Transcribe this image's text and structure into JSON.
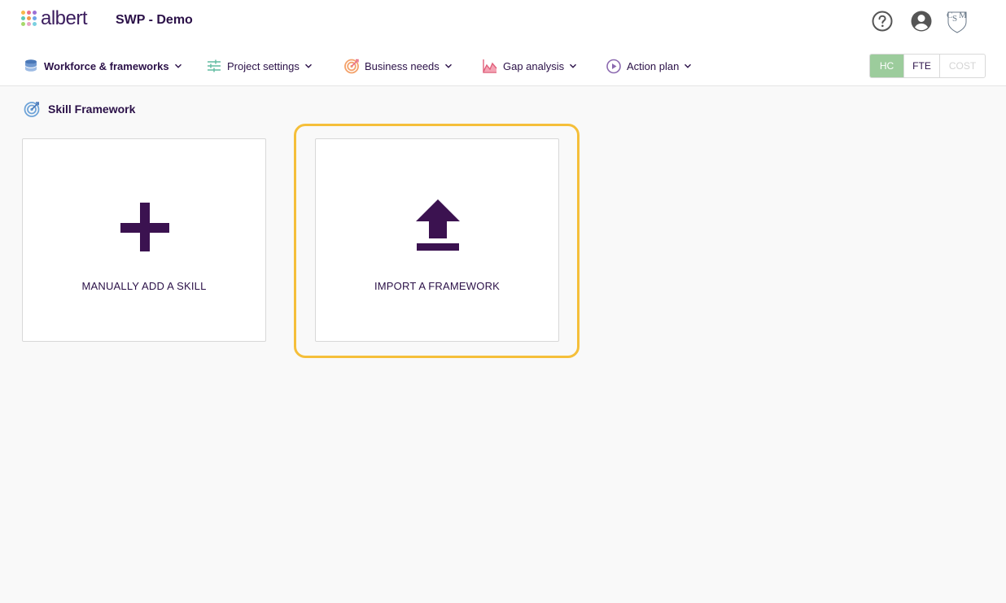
{
  "app": {
    "logo_text": "albert",
    "title": "SWP - Demo"
  },
  "nav": {
    "items": [
      {
        "label": "Workforce & frameworks",
        "icon": "database-icon"
      },
      {
        "label": "Project settings",
        "icon": "sliders-icon"
      },
      {
        "label": "Business needs",
        "icon": "target-icon"
      },
      {
        "label": "Gap analysis",
        "icon": "area-chart-icon"
      },
      {
        "label": "Action plan",
        "icon": "play-circle-icon"
      }
    ]
  },
  "view_toggle": {
    "options": [
      "HC",
      "FTE",
      "COST"
    ],
    "selected": "HC"
  },
  "section": {
    "title": "Skill Framework"
  },
  "cards": [
    {
      "label": "MANUALLY ADD A SKILL",
      "icon": "plus-icon"
    },
    {
      "label": "IMPORT A FRAMEWORK",
      "icon": "upload-icon"
    }
  ],
  "colors": {
    "primary": "#3b1250",
    "active_toggle": "#9ccc9c",
    "highlight": "#f5bf3a"
  }
}
